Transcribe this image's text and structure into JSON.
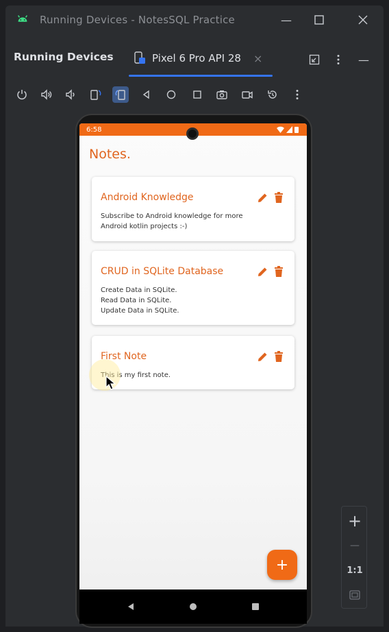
{
  "window": {
    "title": "Running Devices - NotesSQL Practice",
    "controls": [
      "minimize-icon",
      "maximize-icon",
      "close-icon"
    ]
  },
  "panel": {
    "title": "Running Devices",
    "tab": {
      "label": "Pixel 6 Pro API 28",
      "close": "×"
    },
    "actions": [
      "new-tab-icon",
      "more-options-icon",
      "hide-icon"
    ]
  },
  "toolbar": {
    "buttons": [
      "power-icon",
      "volume-up-icon",
      "volume-down-icon",
      "rotate-left-icon",
      "rotate-right-icon",
      "back-icon",
      "home-icon",
      "overview-icon",
      "screenshot-icon",
      "screen-record-icon",
      "reset-icon",
      "more-icon"
    ]
  },
  "device": {
    "status": {
      "time": "6:58"
    },
    "app_title": "Notes.",
    "notes": [
      {
        "title": "Android Knowledge",
        "body": "Subscribe to Android knowledge for more\nAndroid kotlin projects :-)"
      },
      {
        "title": "CRUD in SQLite Database",
        "body": "Create Data in SQLite.\nRead Data in SQLite.\nUpdate Data in SQLite."
      },
      {
        "title": "First Note",
        "body": "This is my first note."
      }
    ],
    "fab_label": "+"
  },
  "zoom": {
    "zoom_in": "+",
    "zoom_out": "—",
    "actual_size": "1:1"
  },
  "colors": {
    "accent": "#F06A16",
    "title": "#E0651F",
    "ide_bg": "#2B2D30",
    "tab_underline": "#3574F0"
  }
}
